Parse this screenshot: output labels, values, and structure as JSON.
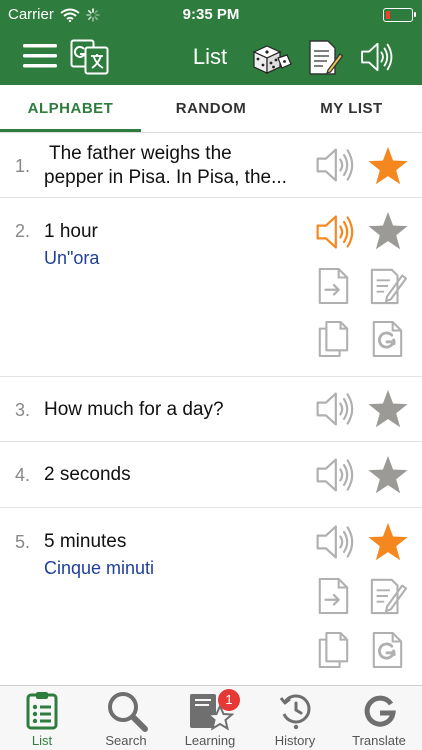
{
  "status": {
    "carrier": "Carrier",
    "time": "9:35 PM"
  },
  "nav": {
    "title": "List"
  },
  "tabs": [
    {
      "label": "ALPHABET",
      "active": true
    },
    {
      "label": "RANDOM",
      "active": false
    },
    {
      "label": "MY LIST",
      "active": false
    }
  ],
  "rows": [
    {
      "num": "1.",
      "text_line1": "The father weighs the",
      "text_line2": "pepper in Pisa. In Pisa, the...",
      "starred": true,
      "speaker_active": false
    },
    {
      "num": "2.",
      "text": "1 hour",
      "translation": "Un\"ora",
      "starred": false,
      "speaker_active": true
    },
    {
      "num": "3.",
      "text": "How much for a day?",
      "starred": false,
      "speaker_active": false
    },
    {
      "num": "4.",
      "text": "2 seconds",
      "starred": false,
      "speaker_active": false
    },
    {
      "num": "5.",
      "text": "5 minutes",
      "translation": "Cinque minuti",
      "starred": true,
      "speaker_active": false
    }
  ],
  "bottom_tabs": [
    {
      "label": "List",
      "icon": "clipboard-list-icon",
      "active": true
    },
    {
      "label": "Search",
      "icon": "magnifier-icon",
      "active": false
    },
    {
      "label": "Learning",
      "icon": "learning-book-star-icon",
      "badge": "1",
      "active": false
    },
    {
      "label": "History",
      "icon": "history-clock-icon",
      "active": false
    },
    {
      "label": "Translate",
      "icon": "google-g-icon",
      "active": false
    }
  ],
  "colors": {
    "brand_green": "#2e7d3e",
    "star_active": "#f5871f",
    "star_inactive": "#9c9a96",
    "speaker_active": "#f5871f",
    "icon_gray": "#b0b0b0",
    "translation_blue": "#1f3f99",
    "badge_red": "#e53935"
  }
}
